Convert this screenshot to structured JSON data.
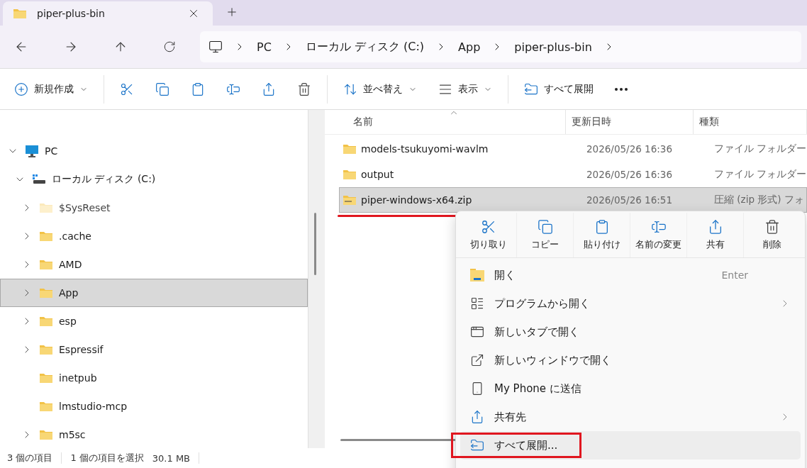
{
  "tab": {
    "title": "piper-plus-bin",
    "selected": true
  },
  "breadcrumbs": [
    "PC",
    "ローカル ディスク (C:)",
    "App",
    "piper-plus-bin"
  ],
  "toolbar": [
    [
      {
        "kind": "new",
        "label": "新規作成",
        "dropdown": true
      }
    ],
    [
      {
        "kind": "cut"
      },
      {
        "kind": "copy"
      },
      {
        "kind": "paste"
      },
      {
        "kind": "rename"
      },
      {
        "kind": "share"
      },
      {
        "kind": "delete"
      }
    ],
    [
      {
        "kind": "sort",
        "label": "並べ替え",
        "dropdown": true
      },
      {
        "kind": "view",
        "label": "表示",
        "dropdown": true
      }
    ],
    [
      {
        "kind": "extract",
        "label": "すべて展開",
        "dropdown": false
      },
      {
        "kind": "more"
      }
    ]
  ],
  "tree": [
    {
      "kind": "pc",
      "label": "PC",
      "expandable": true,
      "expanded": true,
      "selected": false,
      "hidden": false,
      "children": [
        {
          "kind": "drive",
          "label": "ローカル ディスク (C:)",
          "expandable": true,
          "expanded": true,
          "selected": false,
          "hidden": false,
          "children": [
            {
              "kind": "folder",
              "label": "$SysReset",
              "expandable": true,
              "expanded": false,
              "selected": false,
              "hidden": true
            },
            {
              "kind": "folder",
              "label": ".cache",
              "expandable": true,
              "expanded": false,
              "selected": false,
              "hidden": false
            },
            {
              "kind": "folder",
              "label": "AMD",
              "expandable": true,
              "expanded": false,
              "selected": false,
              "hidden": false
            },
            {
              "kind": "folder",
              "label": "App",
              "expandable": true,
              "expanded": false,
              "selected": true,
              "hidden": false
            },
            {
              "kind": "folder",
              "label": "esp",
              "expandable": true,
              "expanded": false,
              "selected": false,
              "hidden": false
            },
            {
              "kind": "folder",
              "label": "Espressif",
              "expandable": true,
              "expanded": false,
              "selected": false,
              "hidden": false
            },
            {
              "kind": "folder",
              "label": "inetpub",
              "expandable": false,
              "selected": false,
              "hidden": false
            },
            {
              "kind": "folder",
              "label": "lmstudio-mcp",
              "expandable": false,
              "selected": false,
              "hidden": false
            },
            {
              "kind": "folder",
              "label": "m5sc",
              "expandable": true,
              "expanded": false,
              "selected": false,
              "hidden": false
            }
          ]
        }
      ]
    }
  ],
  "table": {
    "columns": [
      {
        "label": "名前",
        "sorted": true
      },
      {
        "label": "更新日時",
        "sorted": false
      },
      {
        "label": "種類",
        "sorted": false
      }
    ],
    "rows": [
      {
        "kind": "folder",
        "name": "models-tsukuyomi-wavlm",
        "modified": "2026/05/26 16:36",
        "type": "ファイル フォルダー",
        "selected": false,
        "underlined": false
      },
      {
        "kind": "folder",
        "name": "output",
        "modified": "2026/05/26 16:36",
        "type": "ファイル フォルダー",
        "selected": false,
        "underlined": false
      },
      {
        "kind": "zip",
        "name": "piper-windows-x64.zip",
        "modified": "2026/05/26 16:51",
        "type": "圧縮 (zip 形式) フォ",
        "selected": true,
        "underlined": true
      }
    ]
  },
  "context_menu": {
    "actions": [
      {
        "kind": "cut",
        "label": "切り取り"
      },
      {
        "kind": "copy",
        "label": "コピー"
      },
      {
        "kind": "paste",
        "label": "貼り付け"
      },
      {
        "kind": "rename",
        "label": "名前の変更"
      },
      {
        "kind": "share",
        "label": "共有"
      },
      {
        "kind": "delete",
        "label": "削除"
      }
    ],
    "items": [
      {
        "kind": "open",
        "label": "開く",
        "shortcut": "Enter",
        "submenu": false,
        "hovered": false,
        "framed": false
      },
      {
        "kind": "openwith",
        "label": "プログラムから開く",
        "submenu": true,
        "hovered": false,
        "framed": false
      },
      {
        "kind": "newtab",
        "label": "新しいタブで開く",
        "submenu": false,
        "hovered": false,
        "framed": false
      },
      {
        "kind": "newwindow",
        "label": "新しいウィンドウで開く",
        "submenu": false,
        "hovered": false,
        "framed": false
      },
      {
        "kind": "phone",
        "label": "My Phone に送信",
        "submenu": false,
        "hovered": false,
        "framed": false
      },
      {
        "kind": "share",
        "label": "共有先",
        "submenu": true,
        "hovered": false,
        "framed": false
      },
      {
        "kind": "extract",
        "label": "すべて展開...",
        "submenu": false,
        "hovered": true,
        "framed": true
      }
    ]
  },
  "status_bar": {
    "count": "3 個の項目",
    "selection": "1 個の項目を選択",
    "size": "30.1 MB"
  }
}
